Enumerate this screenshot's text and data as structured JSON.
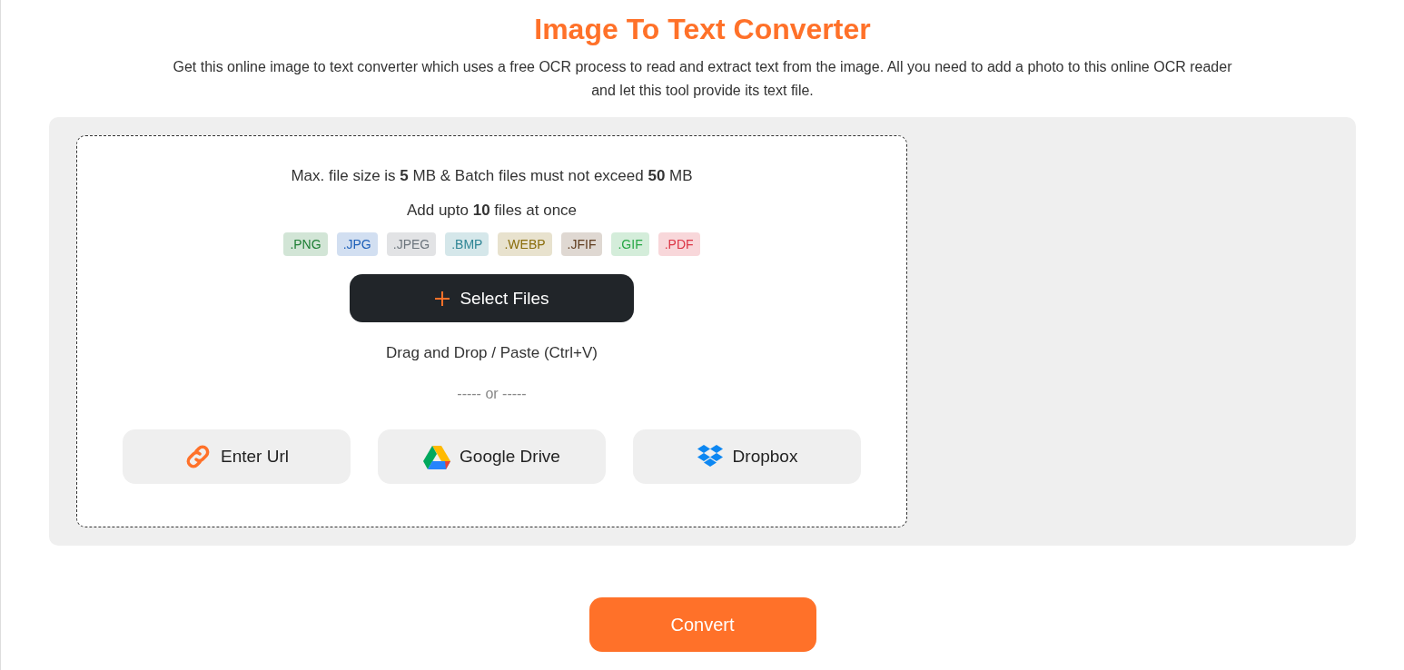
{
  "title": "Image To Text Converter",
  "description": "Get this online image to text converter which uses a free OCR process to read and extract text from the image. All you need to add a photo to this online OCR reader and let this tool provide its text file.",
  "upload": {
    "size_note": "Max. file size is **5** MB & Batch files must not exceed **50** MB",
    "count_note": "Add upto **10** files at once",
    "formats": [
      {
        "label": ".PNG",
        "color": "#1e7e34"
      },
      {
        "label": ".JPG",
        "color": "#1c5fb8"
      },
      {
        "label": ".JPEG",
        "color": "#6c757d"
      },
      {
        "label": ".BMP",
        "color": "#2f8595"
      },
      {
        "label": ".WEBP",
        "color": "#8a6d0b"
      },
      {
        "label": ".JFIF",
        "color": "#5e3a1c"
      },
      {
        "label": ".GIF",
        "color": "#28a745"
      },
      {
        "label": ".PDF",
        "color": "#dc3545"
      }
    ],
    "select_button": "Select Files",
    "drag_hint": "Drag and Drop / Paste (Ctrl+V)",
    "separator": "----- or -----",
    "sources": [
      {
        "kind": "link",
        "label": "Enter Url"
      },
      {
        "kind": "gdrive",
        "label": "Google Drive"
      },
      {
        "kind": "dropbox",
        "label": "Dropbox"
      }
    ]
  },
  "convert_button": "Convert"
}
